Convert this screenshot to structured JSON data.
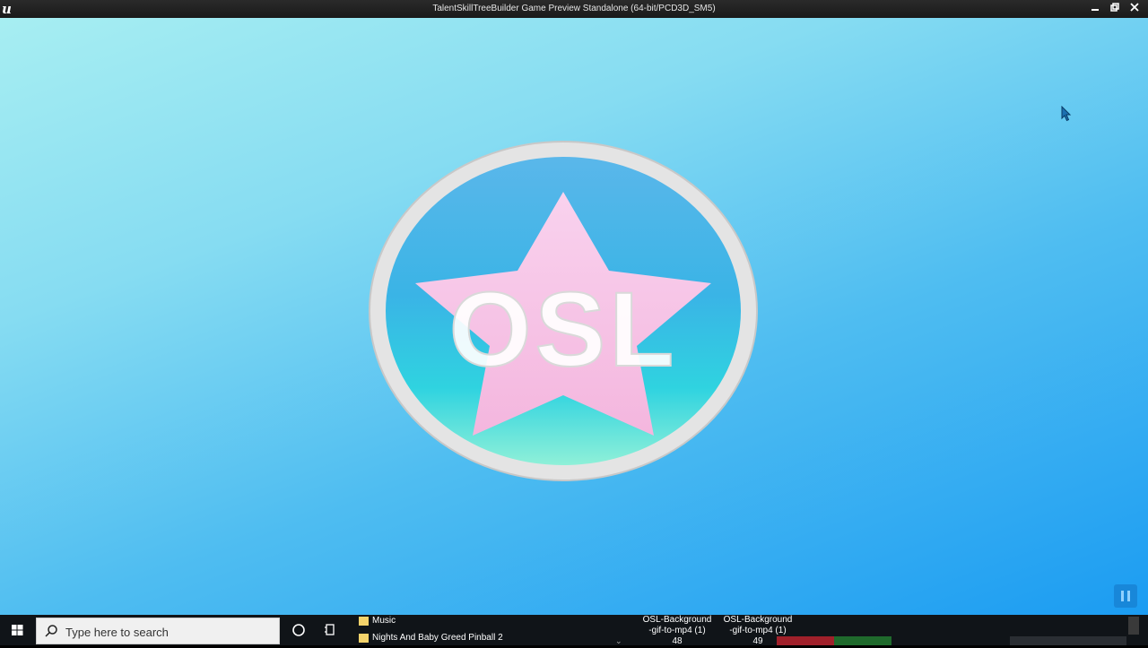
{
  "window": {
    "logo_glyph": "u",
    "title": "TalentSkillTreeBuilder Game Preview Standalone (64-bit/PCD3D_SM5)",
    "controls": [
      "minimize-icon",
      "restore-icon",
      "close-icon"
    ]
  },
  "emblem": {
    "text": "OSL",
    "colors": {
      "ring": "#e2e2e2",
      "disk_top": "#5ab7ea",
      "disk_bottom": "#8ff0d8",
      "star": "#f7c4e6",
      "text": "#ffffff"
    }
  },
  "viewport": {
    "colors": {
      "bg_top_left": "#a7eef2",
      "bg_bottom_right": "#1b9cf2"
    },
    "pause_icon": "pause-icon"
  },
  "taskbar": {
    "search_placeholder": "Type here to search",
    "jump_items": [
      {
        "label": "Music"
      },
      {
        "label": "Nights And Baby Greed Pinball 2"
      }
    ],
    "apps": [
      {
        "line1": "OSL-Background",
        "line2": "-gif-to-mp4 (1)",
        "line3": "48"
      },
      {
        "line1": "OSL-Background",
        "line2": "-gif-to-mp4 (1)",
        "line3": "49"
      }
    ]
  }
}
